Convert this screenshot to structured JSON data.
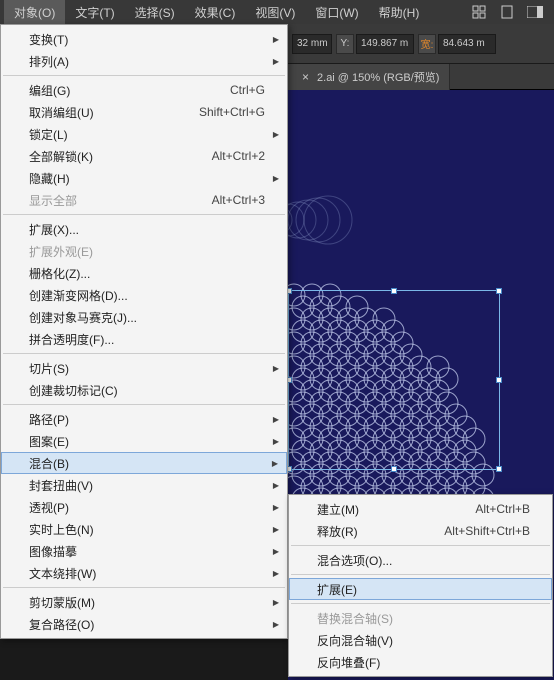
{
  "menubar": {
    "items": [
      "对象(O)",
      "文字(T)",
      "选择(S)",
      "效果(C)",
      "视图(V)",
      "窗口(W)",
      "帮助(H)"
    ]
  },
  "toolbar": {
    "x_value": "32 mm",
    "y_label": "Y:",
    "y_value": "149.867 m",
    "w_label": "宽:",
    "w_value": "84.643 m"
  },
  "tab": {
    "title": "2.ai @ 150% (RGB/预览)"
  },
  "object_menu": {
    "transform": "变换(T)",
    "arrange": "排列(A)",
    "group": "编组(G)",
    "group_sc": "Ctrl+G",
    "ungroup": "取消编组(U)",
    "ungroup_sc": "Shift+Ctrl+G",
    "lock": "锁定(L)",
    "unlock_all": "全部解锁(K)",
    "unlock_all_sc": "Alt+Ctrl+2",
    "hide": "隐藏(H)",
    "show_all": "显示全部",
    "show_all_sc": "Alt+Ctrl+3",
    "expand": "扩展(X)...",
    "expand_appearance": "扩展外观(E)",
    "rasterize": "栅格化(Z)...",
    "gradient_mesh": "创建渐变网格(D)...",
    "object_mosaic": "创建对象马赛克(J)...",
    "flatten_transparency": "拼合透明度(F)...",
    "slice": "切片(S)",
    "crop_marks": "创建裁切标记(C)",
    "path": "路径(P)",
    "pattern": "图案(E)",
    "blend": "混合(B)",
    "envelope": "封套扭曲(V)",
    "perspective": "透视(P)",
    "live_paint": "实时上色(N)",
    "image_trace": "图像描摹",
    "text_wrap": "文本绕排(W)",
    "clipping_mask": "剪切蒙版(M)",
    "compound_path": "复合路径(O)"
  },
  "blend_submenu": {
    "make": "建立(M)",
    "make_sc": "Alt+Ctrl+B",
    "release": "释放(R)",
    "release_sc": "Alt+Shift+Ctrl+B",
    "options": "混合选项(O)...",
    "expand": "扩展(E)",
    "replace_spine": "替换混合轴(S)",
    "reverse_spine": "反向混合轴(V)",
    "reverse_front": "反向堆叠(F)"
  }
}
